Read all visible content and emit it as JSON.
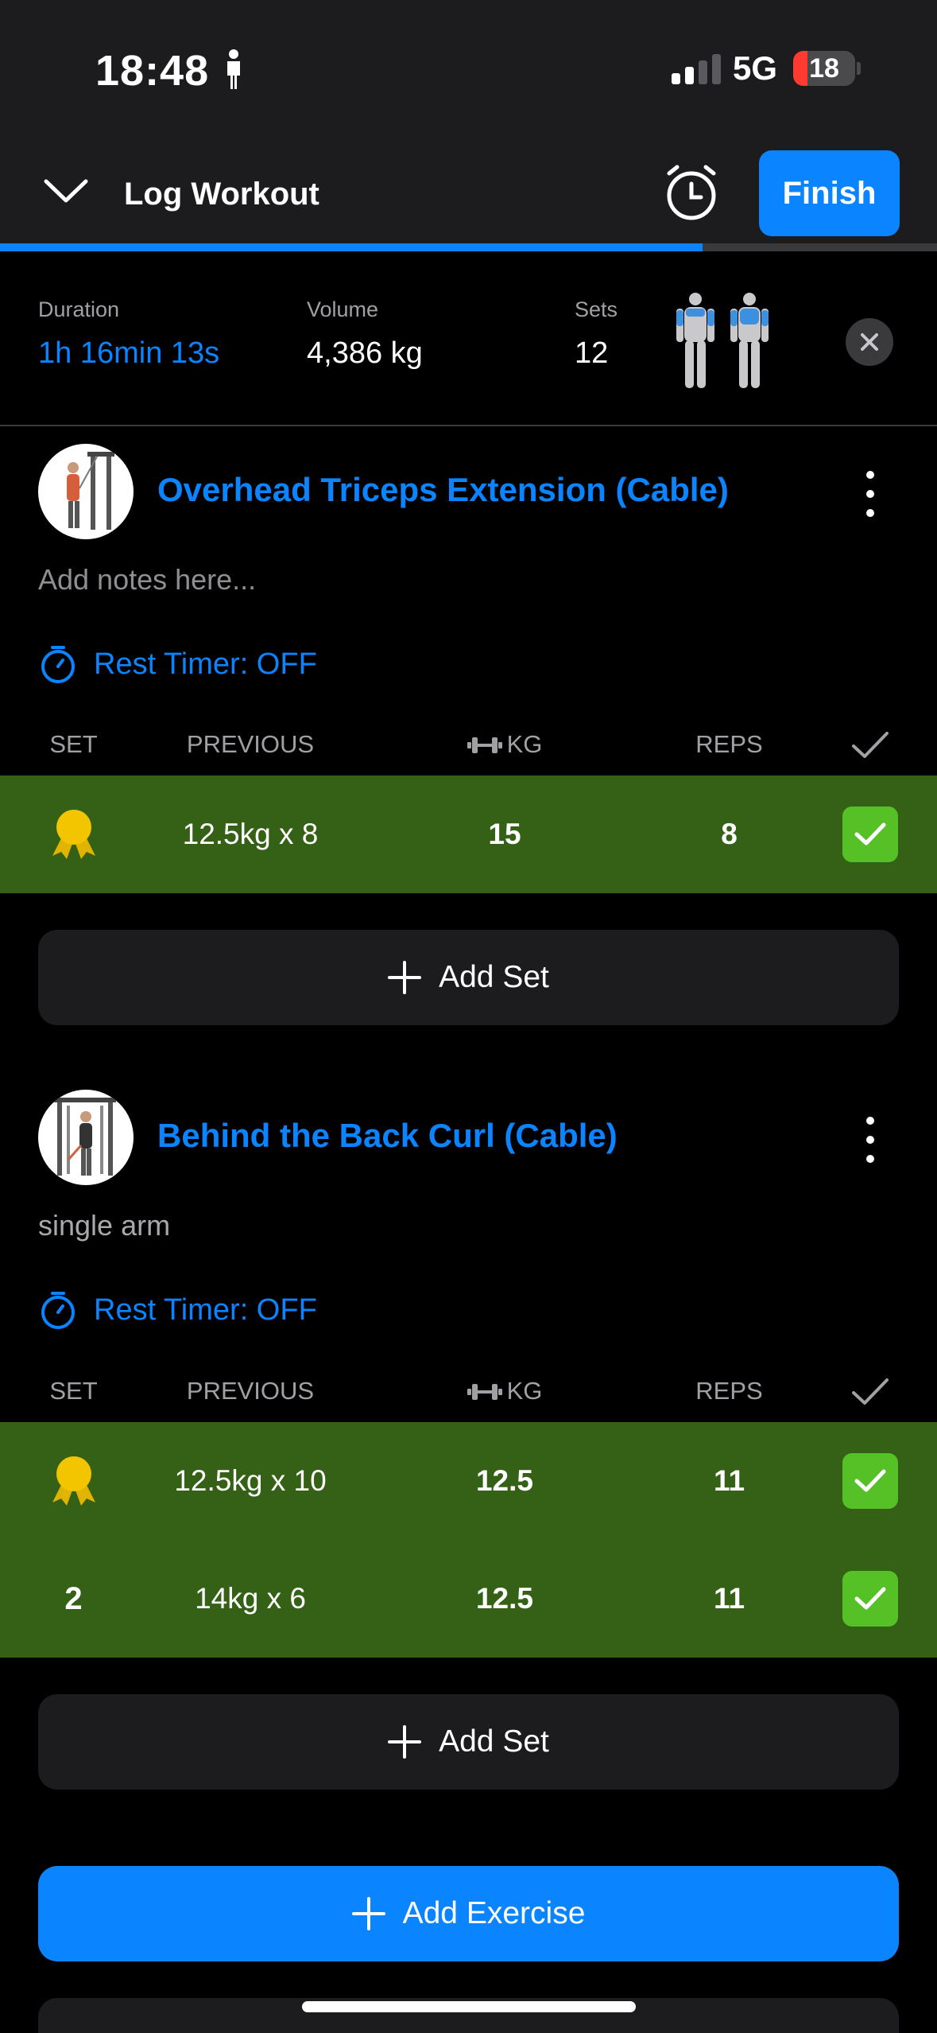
{
  "status_bar": {
    "time": "18:48",
    "network": "5G",
    "battery": "18"
  },
  "header": {
    "title": "Log Workout",
    "finish_label": "Finish",
    "progress_fraction": 0.75
  },
  "summary": {
    "duration_label": "Duration",
    "duration_value": "1h 16min 13s",
    "volume_label": "Volume",
    "volume_value": "4,386 kg",
    "sets_label": "Sets",
    "sets_value": "12"
  },
  "columns": {
    "set": "SET",
    "previous": "PREVIOUS",
    "kg": "KG",
    "reps": "REPS"
  },
  "exercises": [
    {
      "name": "Overhead Triceps Extension (Cable)",
      "notes": "Add notes here...",
      "rest_timer": "Rest Timer: OFF",
      "sets": [
        {
          "set": "",
          "previous": "12.5kg x 8",
          "kg": "15",
          "reps": "8",
          "completed": true
        }
      ],
      "add_set_label": "Add Set"
    },
    {
      "name": "Behind the Back Curl (Cable)",
      "notes": "single arm",
      "rest_timer": "Rest Timer: OFF",
      "sets": [
        {
          "set": "",
          "previous": "12.5kg x 10",
          "kg": "12.5",
          "reps": "11",
          "completed": true
        },
        {
          "set": "2",
          "previous": "14kg x 6",
          "kg": "12.5",
          "reps": "11",
          "completed": true
        }
      ],
      "add_set_label": "Add Set"
    }
  ],
  "add_exercise_label": "Add Exercise",
  "colors": {
    "accent": "#0a84ff",
    "completed_row": "#356117",
    "check_green": "#55c126",
    "pr_gold": "#f2c500"
  }
}
